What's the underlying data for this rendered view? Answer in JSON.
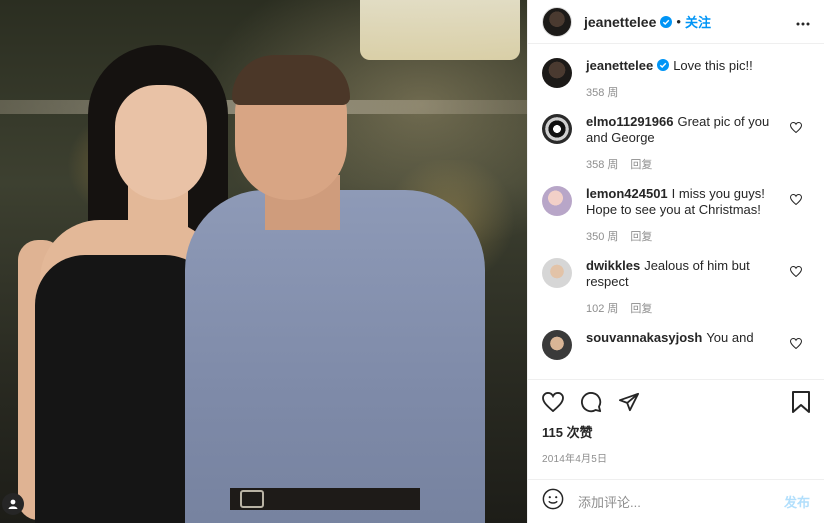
{
  "post": {
    "author": "jeanettelee",
    "follow_label": "关注",
    "dot": "•",
    "caption": {
      "username": "jeanettelee",
      "text": "Love this pic!!",
      "time": "358 周"
    },
    "comments": [
      {
        "username": "elmo11291966",
        "text": "Great pic of you and George",
        "time": "358 周",
        "reply": "回复"
      },
      {
        "username": "lemon424501",
        "text": "I miss you guys! Hope to see you at Christmas!",
        "time": "350 周",
        "reply": "回复"
      },
      {
        "username": "dwikkles",
        "text": "Jealous of him but respect",
        "time": "102 周",
        "reply": "回复"
      },
      {
        "username": "souvannakasyjosh",
        "text": "You and",
        "time": "",
        "reply": ""
      }
    ],
    "likes": "115 次赞",
    "date": "2014年4月5日",
    "add_comment_placeholder": "添加评论...",
    "post_button": "发布"
  },
  "colors": {
    "accent": "#0095f6",
    "post_disabled": "#b2dffc",
    "muted": "#8e8e8e"
  },
  "icons": [
    "verified-badge-icon",
    "more-icon",
    "heart-icon",
    "comment-icon",
    "share-icon",
    "save-icon",
    "emoji-icon",
    "user-tag-icon"
  ]
}
